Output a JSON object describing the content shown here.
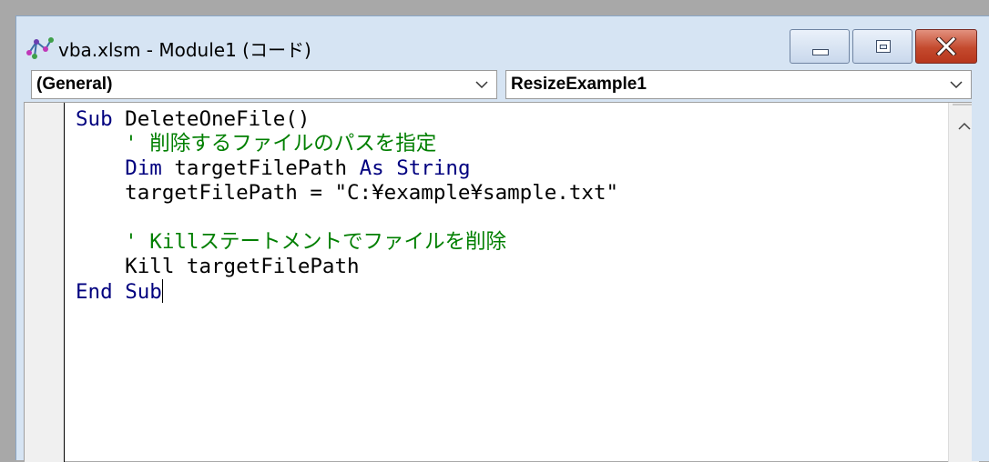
{
  "window": {
    "title": "vba.xlsm - Module1 (コード)",
    "icon": "vba-module-icon"
  },
  "caption_buttons": {
    "minimize": "minimize-icon",
    "maximize": "maximize-icon",
    "close": "close-icon"
  },
  "combos": {
    "object": {
      "value": "(General)"
    },
    "procedure": {
      "value": "ResizeExample1"
    }
  },
  "code": {
    "lines": [
      [
        {
          "t": "Sub",
          "c": "kw"
        },
        {
          "t": " DeleteOneFile()",
          "c": "tx"
        }
      ],
      [
        {
          "t": "    ' 削除するファイルのパスを指定",
          "c": "cm"
        }
      ],
      [
        {
          "t": "    ",
          "c": "tx"
        },
        {
          "t": "Dim",
          "c": "kw"
        },
        {
          "t": " targetFilePath ",
          "c": "tx"
        },
        {
          "t": "As",
          "c": "kw"
        },
        {
          "t": " ",
          "c": "tx"
        },
        {
          "t": "String",
          "c": "kw"
        }
      ],
      [
        {
          "t": "    targetFilePath = \"C:¥example¥sample.txt\"",
          "c": "tx"
        }
      ],
      [
        {
          "t": "",
          "c": "tx"
        }
      ],
      [
        {
          "t": "    ' Killステートメントでファイルを削除",
          "c": "cm"
        }
      ],
      [
        {
          "t": "    Kill targetFilePath",
          "c": "tx"
        }
      ],
      [
        {
          "t": "End",
          "c": "kw"
        },
        {
          "t": " ",
          "c": "tx"
        },
        {
          "t": "Sub",
          "c": "kw"
        }
      ]
    ]
  },
  "colors": {
    "keyword": "#00007f",
    "comment": "#007f00",
    "text": "#000000",
    "titlebar": "#d6e4f3",
    "close_button": "#c44a2e"
  }
}
